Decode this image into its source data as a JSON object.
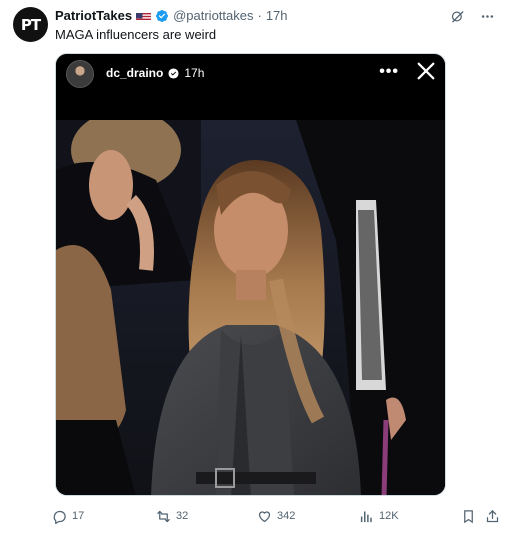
{
  "tweet": {
    "avatar_text": "PT",
    "display_name": "PatriotTakes",
    "handle": "@patriottakes",
    "separator": "·",
    "time": "17h",
    "text": "MAGA influencers are weird"
  },
  "story": {
    "username": "dc_draino",
    "time": "17h"
  },
  "actions": {
    "replies": "17",
    "reposts": "32",
    "likes": "342",
    "views": "12K"
  },
  "colors": {
    "text_secondary": "#536471",
    "verified": "#1d9bf0"
  },
  "icons": [
    "grok-icon",
    "more-icon",
    "story-more-icon",
    "close-icon",
    "reply-icon",
    "repost-icon",
    "like-icon",
    "views-icon",
    "bookmark-icon",
    "share-icon",
    "verified-badge-icon",
    "us-flag-icon"
  ]
}
